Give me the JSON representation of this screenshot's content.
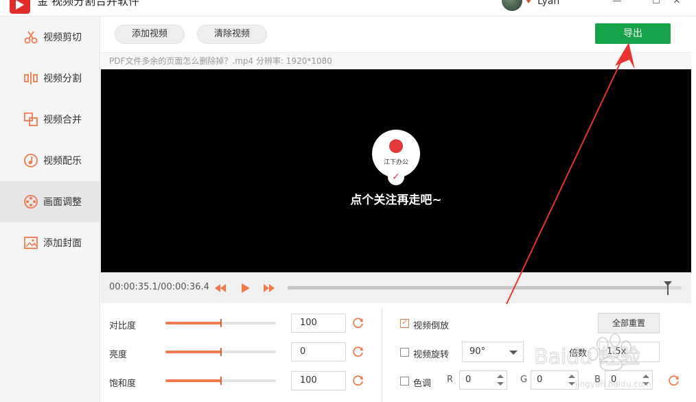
{
  "app": {
    "title": "金 视频分割合并软件",
    "user_name": "Lyan"
  },
  "sidebar": {
    "items": [
      {
        "label": "视频剪切",
        "icon": "scissors-icon"
      },
      {
        "label": "视频分割",
        "icon": "split-icon"
      },
      {
        "label": "视频合并",
        "icon": "merge-icon"
      },
      {
        "label": "视频配乐",
        "icon": "music-icon"
      },
      {
        "label": "画面调整",
        "icon": "film-reel-icon",
        "active": true
      },
      {
        "label": "添加封面",
        "icon": "image-icon"
      }
    ]
  },
  "toolbar": {
    "add_video": "添加视频",
    "clear_video": "清除视频",
    "export": "导出"
  },
  "file_info": "PDF文件多余的页面怎么删除掉？.mp4    分辨率: 1920*1080",
  "video": {
    "overlay_brand": "江下办公",
    "overlay_caption": "点个关注再走吧~"
  },
  "playback": {
    "timecode": "00:00:35.1/00:00:36.4",
    "progress": 0.966
  },
  "adjust": {
    "contrast": {
      "label": "对比度",
      "value": "100",
      "level": 0.5
    },
    "brightness": {
      "label": "亮度",
      "value": "0",
      "level": 0.5
    },
    "saturation": {
      "label": "饱和度",
      "value": "100",
      "level": 0.5
    }
  },
  "options": {
    "reverse": {
      "label": "视频倒放",
      "checked": true
    },
    "rotate": {
      "label": "视频旋转",
      "checked": false,
      "value": "90°"
    },
    "tint": {
      "label": "色调",
      "checked": false,
      "r": "0",
      "g": "0",
      "b": "0"
    },
    "reset_all": "全部重置",
    "multiplier_label": "倍数",
    "multiplier_value": "1.5x",
    "r_label": "R",
    "g_label": "G",
    "b_label": "B"
  },
  "watermark": {
    "text": "Baidu 经验",
    "subtext": "jingyan.baidu.com"
  },
  "colors": {
    "accent": "#f2794a",
    "export_green": "#16a34a",
    "annotation_red": "#e8332e"
  }
}
